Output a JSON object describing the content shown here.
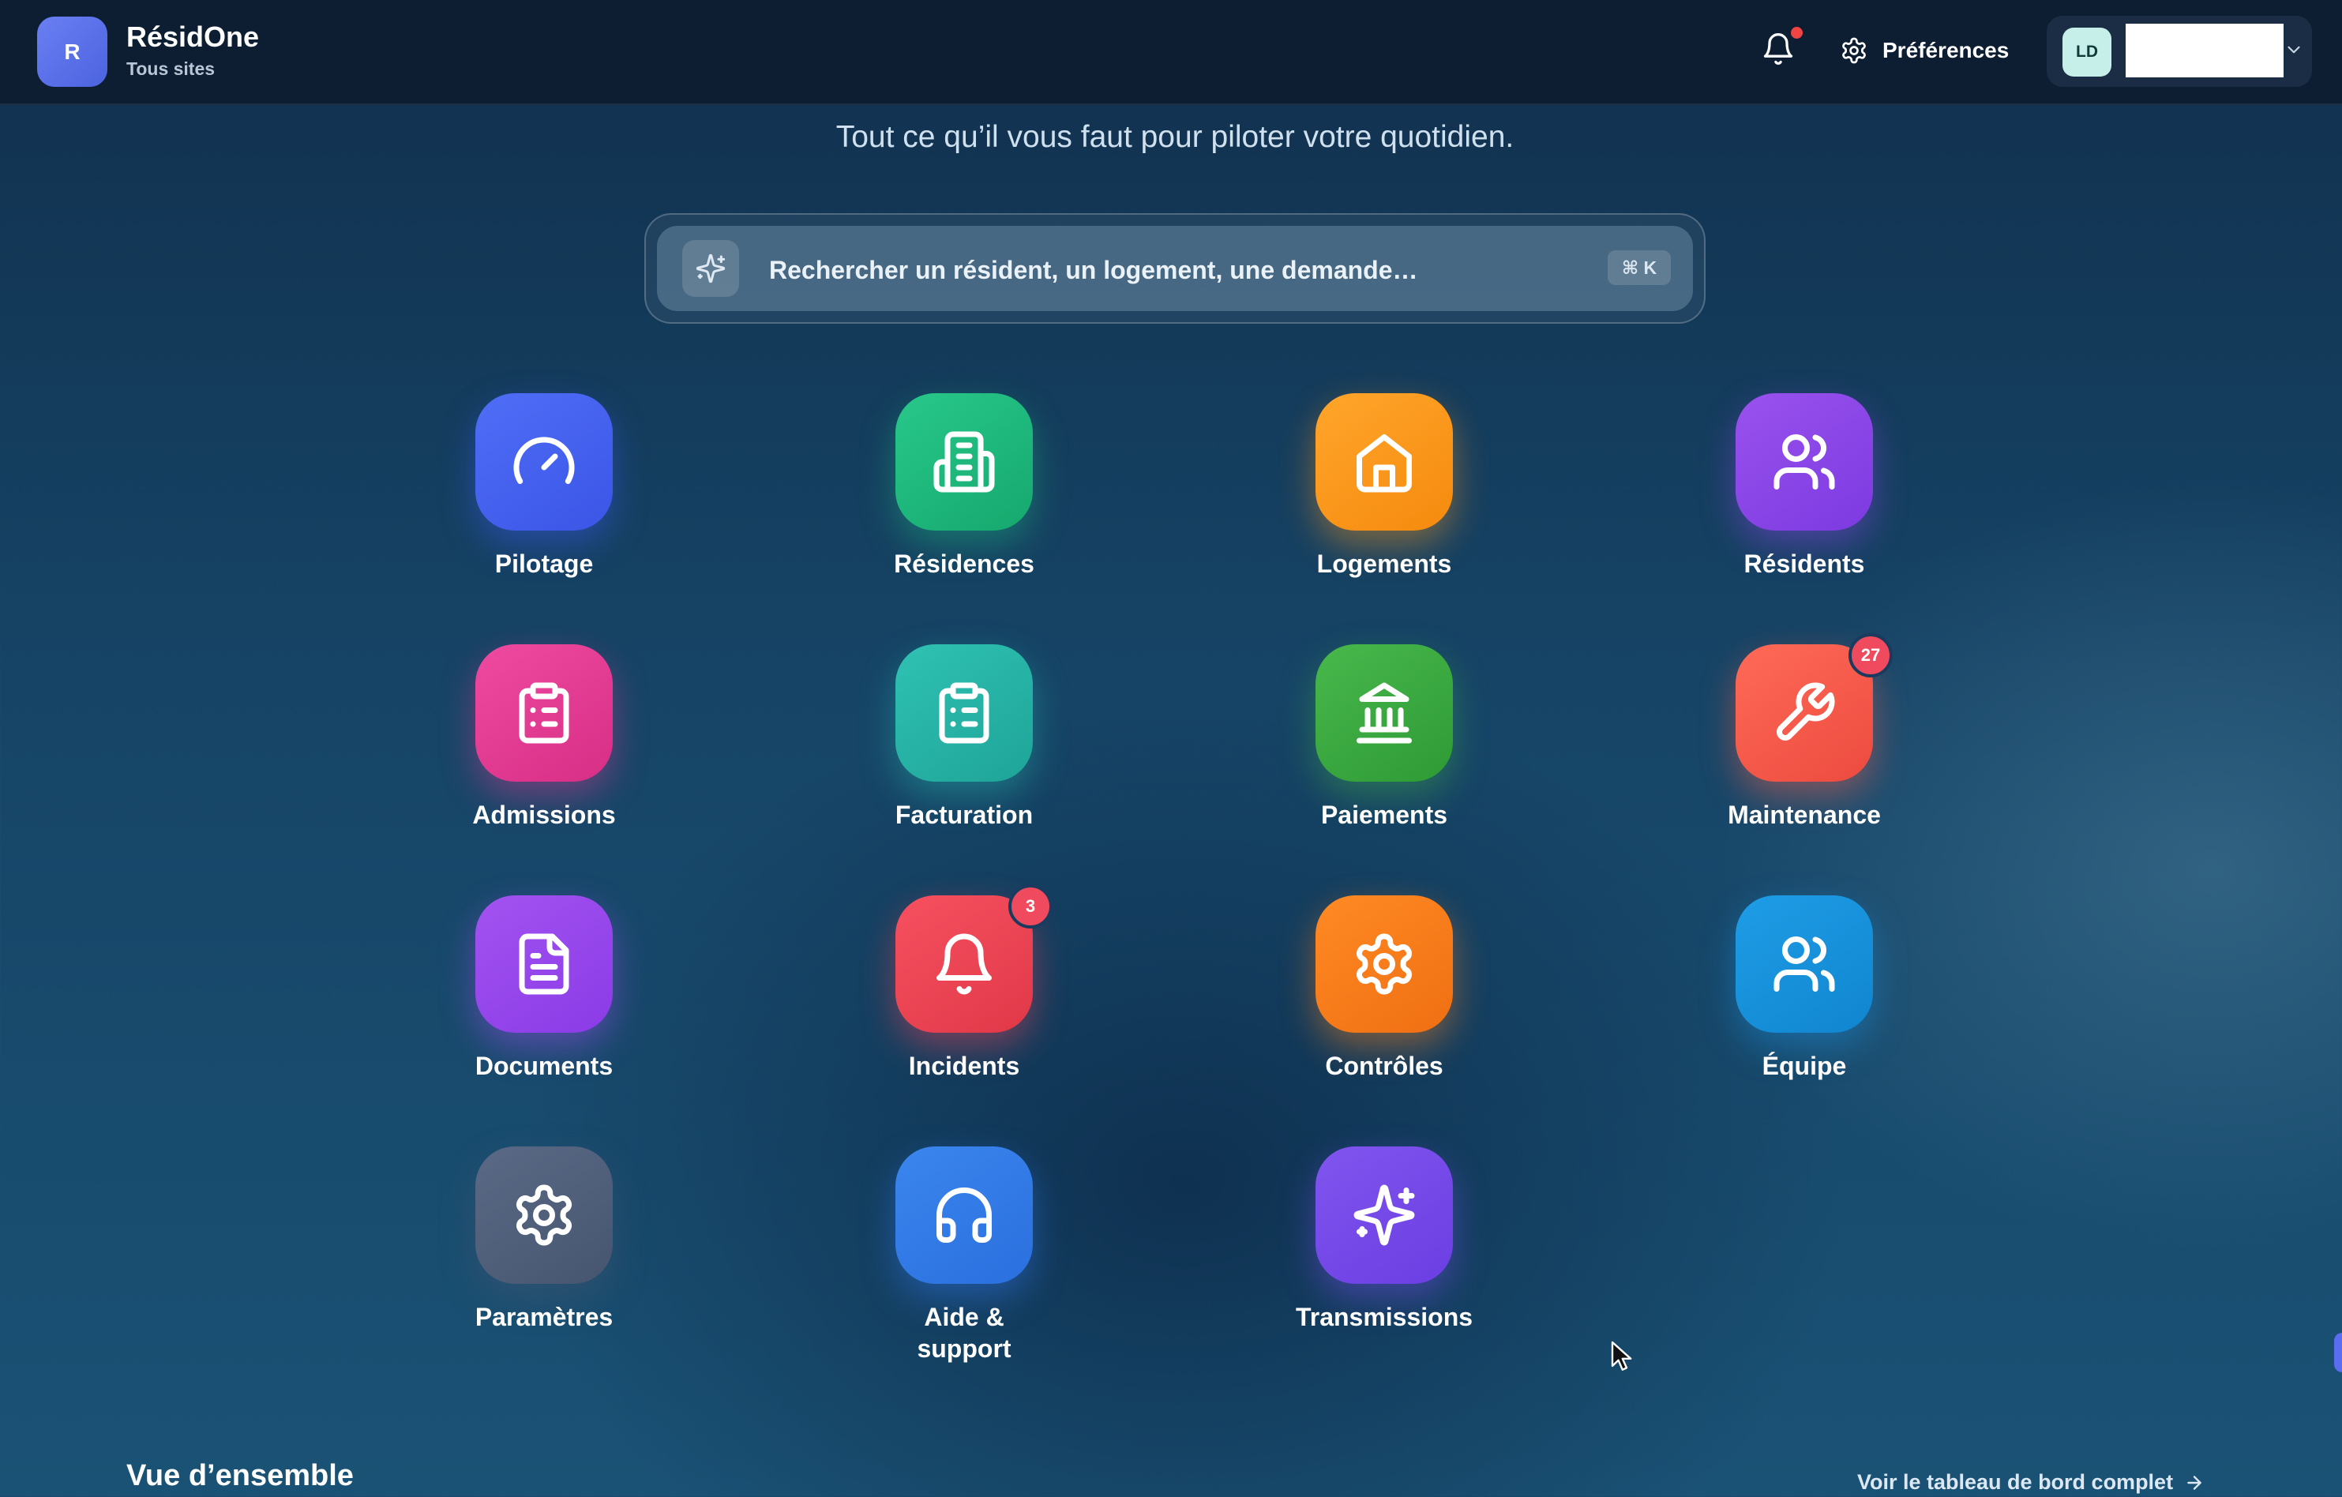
{
  "header": {
    "brand_initial": "R",
    "brand_name": "RésidOne",
    "brand_scope": "Tous sites",
    "notifications_has_unread": true,
    "preferences_label": "Préférences",
    "user_initials": "LD",
    "user_name": ""
  },
  "hero": {
    "tagline": "Tout ce qu’il vous faut pour piloter votre quotidien.",
    "search_placeholder": "Rechercher un résident, un logement, une demande…",
    "search_shortcut": "⌘ K"
  },
  "apps": [
    {
      "label": "Pilotage",
      "icon": "gauge-icon",
      "color": "#4f6ef7"
    },
    {
      "label": "Résidences",
      "icon": "building-icon",
      "color": "#28c88a"
    },
    {
      "label": "Logements",
      "icon": "house-icon",
      "color": "#ffa62b"
    },
    {
      "label": "Résidents",
      "icon": "users-icon",
      "color": "#9a52ee"
    },
    {
      "label": "Admissions",
      "icon": "clipboard-list-icon",
      "color": "#ef4aa0"
    },
    {
      "label": "Facturation",
      "icon": "clipboard-list-icon",
      "color": "#2fc2b3"
    },
    {
      "label": "Paiements",
      "icon": "bank-icon",
      "color": "#48b84c"
    },
    {
      "label": "Maintenance",
      "icon": "wrench-icon",
      "color": "#ff6a57",
      "badge": "27"
    },
    {
      "label": "Documents",
      "icon": "document-icon",
      "color": "#a353f0"
    },
    {
      "label": "Incidents",
      "icon": "bell-icon",
      "color": "#f65160",
      "badge": "3"
    },
    {
      "label": "Contrôles",
      "icon": "gear-icon",
      "color": "#ff8a24"
    },
    {
      "label": "Équipe",
      "icon": "users-icon",
      "color": "#1e9de6"
    },
    {
      "label": "Paramètres",
      "icon": "gear-icon",
      "color": "#5a6a86"
    },
    {
      "label": "Aide & support",
      "icon": "headphones-icon",
      "color": "#3b86ee"
    },
    {
      "label": "Transmissions",
      "icon": "sparkles-icon",
      "color": "#8155ee"
    }
  ],
  "overview": {
    "title": "Vue d’ensemble",
    "link_label": "Voir le tableau de bord complet"
  }
}
